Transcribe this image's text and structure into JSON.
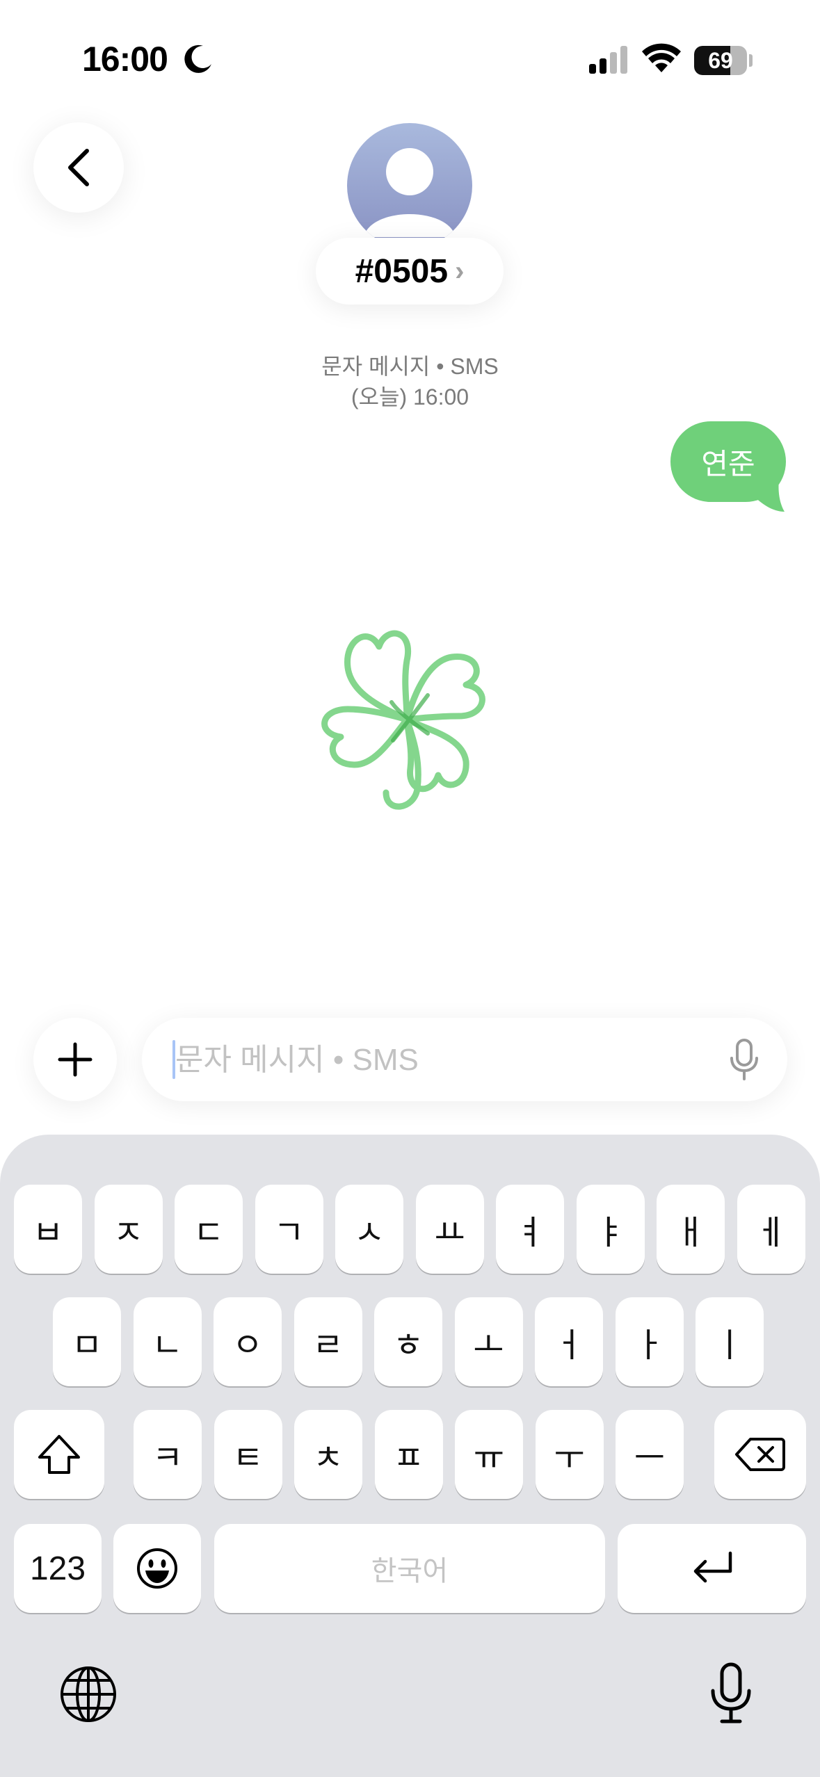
{
  "status_bar": {
    "time": "16:00",
    "focus_icon": "moon-icon",
    "signal_icon": "cellular-signal-icon",
    "wifi_icon": "wifi-icon",
    "battery_level": "69",
    "battery_fraction": 0.69
  },
  "header": {
    "back_icon": "chevron-left-icon",
    "avatar_icon": "person-icon",
    "contact_name": "#0505",
    "contact_chevron": "›",
    "meta_line1": "문자 메시지 • SMS",
    "meta_line2": "(오늘) 16:00"
  },
  "messages": [
    {
      "direction": "outgoing",
      "text": "연준",
      "color": "#6fd07a"
    },
    {
      "direction": "outgoing",
      "type": "handwriting-sketch",
      "color": "#6fd07a"
    }
  ],
  "composer": {
    "add_icon": "plus-icon",
    "placeholder": "문자 메시지 • SMS",
    "value": "",
    "mic_icon": "microphone-icon"
  },
  "keyboard": {
    "row1": [
      "ㅂ",
      "ㅈ",
      "ㄷ",
      "ㄱ",
      "ㅅ",
      "ㅛ",
      "ㅕ",
      "ㅑ",
      "ㅐ",
      "ㅔ"
    ],
    "row2": [
      "ㅁ",
      "ㄴ",
      "ㅇ",
      "ㄹ",
      "ㅎ",
      "ㅗ",
      "ㅓ",
      "ㅏ",
      "ㅣ"
    ],
    "row3": [
      "ㅋ",
      "ㅌ",
      "ㅊ",
      "ㅍ",
      "ㅠ",
      "ㅜ",
      "ㅡ"
    ],
    "shift_icon": "shift-icon",
    "delete_icon": "delete-icon",
    "numbers_label": "123",
    "emoji_icon": "emoji-icon",
    "space_label": "한국어",
    "return_icon": "return-icon",
    "globe_icon": "globe-icon",
    "dictation_icon": "microphone-icon",
    "background": "#e2e3e7"
  }
}
